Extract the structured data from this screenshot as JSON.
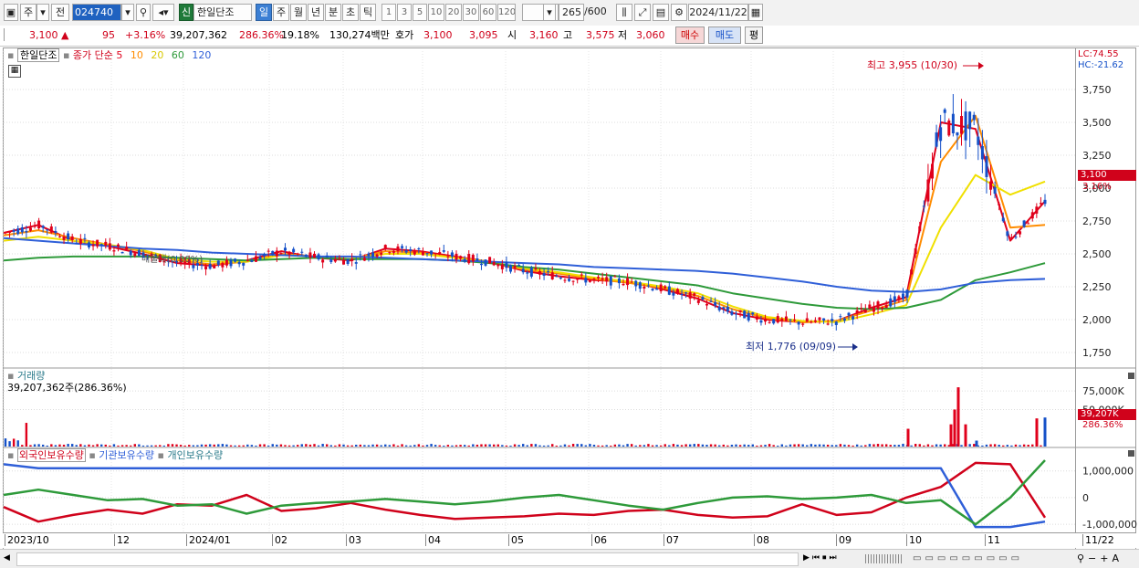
{
  "toolbar": {
    "period_type": "주",
    "prev_label": "전",
    "stock_code": "024740",
    "new_badge": "신",
    "stock_name": "한일단조",
    "period_tabs": [
      "일",
      "주",
      "월",
      "년",
      "분",
      "초",
      "틱"
    ],
    "active_tab": "일",
    "interval_buttons": [
      "1",
      "3",
      "5",
      "10",
      "20",
      "30",
      "60",
      "120"
    ],
    "count_value": "265",
    "count_total": "/600",
    "date": "2024/11/22"
  },
  "quote": {
    "price": "3,100",
    "direction": "▲",
    "change": "95",
    "change_pct": "+3.16%",
    "volume": "39,207,362",
    "volume_ratio": "286.36%",
    "turnover": "19.18%",
    "amount": "130,274백만",
    "bid_ask_label": "호가",
    "bid": "3,100",
    "ask": "3,095",
    "open_label": "시",
    "open": "3,160",
    "high_label": "고",
    "high": "3,575",
    "low_label": "저",
    "low": "3,060",
    "buy_button": "매수",
    "sell_button": "매도",
    "eval_button": "평"
  },
  "price_panel": {
    "legend_name": "한일단조",
    "legend_ma_label": "종가 단순",
    "ma_periods": [
      "5",
      "10",
      "20",
      "60",
      "120"
    ],
    "ma_colors": [
      "#e0001b",
      "#ff8c00",
      "#f0e000",
      "#2e9a3a",
      "#2f5fd8"
    ],
    "lc": "LC:74.55",
    "hc": "HC:-21.62",
    "current_price_tag": "3,100",
    "current_pct_tag": "3.16%",
    "high_note": "최고 3,955 (10/30)",
    "low_note": "최저 1,776 (09/09)",
    "overlay_text": "매물대(0.00%)"
  },
  "volume_panel": {
    "legend": "거래량",
    "value": "39,207,362주(286.36%)",
    "tag_value": "39,207K",
    "tag_pct": "286.36%"
  },
  "investor_panel": {
    "legend_items": [
      "외국인보유수량",
      "기관보유수량",
      "개인보유수량"
    ],
    "legend_colors": [
      "#d0021b",
      "#2f5fd8",
      "#2e9a3a"
    ]
  },
  "x_axis": {
    "labels": [
      "2023/10",
      "12",
      "2024/01",
      "02",
      "03",
      "04",
      "05",
      "06",
      "07",
      "08",
      "09",
      "10",
      "11",
      "11/22"
    ]
  },
  "chart_data": [
    {
      "type": "candlestick",
      "title": "",
      "y_ticks": [
        "3,750",
        "3,500",
        "3,250",
        "3,000",
        "2,750",
        "2,500",
        "2,250",
        "2,000",
        "1,750"
      ],
      "ylim": [
        1750,
        3750
      ],
      "annotations": [
        "최고 3,955 (10/30)",
        "최저 1,776 (09/09)"
      ],
      "series": [
        {
          "name": "5",
          "values": [
            2660,
            2720,
            2600,
            2560,
            2500,
            2430,
            2410,
            2450,
            2520,
            2470,
            2450,
            2540,
            2520,
            2480,
            2440,
            2370,
            2330,
            2300,
            2290,
            2230,
            2160,
            2050,
            2000,
            1980,
            1990,
            2090,
            2170,
            3500,
            3450,
            2600,
            2900
          ]
        },
        {
          "name": "10",
          "values": [
            2640,
            2680,
            2620,
            2570,
            2520,
            2450,
            2420,
            2440,
            2500,
            2480,
            2460,
            2520,
            2510,
            2470,
            2440,
            2380,
            2350,
            2310,
            2280,
            2240,
            2180,
            2080,
            2010,
            1980,
            1990,
            2070,
            2150,
            3200,
            3550,
            2700,
            2720
          ]
        },
        {
          "name": "20",
          "values": [
            2600,
            2630,
            2600,
            2570,
            2530,
            2460,
            2440,
            2440,
            2490,
            2480,
            2460,
            2500,
            2500,
            2470,
            2440,
            2390,
            2360,
            2320,
            2290,
            2250,
            2200,
            2100,
            2020,
            1990,
            1980,
            2040,
            2110,
            2700,
            3100,
            2950,
            3050
          ]
        },
        {
          "name": "60",
          "values": [
            2450,
            2470,
            2480,
            2480,
            2480,
            2470,
            2460,
            2450,
            2460,
            2470,
            2460,
            2460,
            2460,
            2450,
            2430,
            2400,
            2380,
            2350,
            2320,
            2290,
            2260,
            2200,
            2160,
            2120,
            2090,
            2080,
            2090,
            2150,
            2300,
            2360,
            2430
          ]
        },
        {
          "name": "120",
          "values": [
            2620,
            2600,
            2580,
            2560,
            2540,
            2530,
            2510,
            2500,
            2490,
            2480,
            2480,
            2470,
            2460,
            2450,
            2440,
            2430,
            2420,
            2400,
            2390,
            2380,
            2370,
            2350,
            2320,
            2290,
            2250,
            2220,
            2210,
            2230,
            2280,
            2300,
            2310
          ]
        }
      ]
    },
    {
      "type": "bar",
      "title": "거래량",
      "y_ticks": [
        "75,000K",
        "50,000K"
      ],
      "ylim": [
        0,
        90000
      ],
      "highlights": [
        {
          "label": "10",
          "value": 24000
        },
        {
          "label": "10/30",
          "value": 80000
        },
        {
          "label": "11",
          "value": 30000
        },
        {
          "label": "11/22",
          "value": 39207
        }
      ]
    },
    {
      "type": "line",
      "title": "",
      "y_ticks": [
        "1,000,000",
        "0",
        "-1,000,000"
      ],
      "ylim": [
        -1200000,
        1400000
      ],
      "series": [
        {
          "name": "외국인보유수량",
          "values": [
            -350000,
            -900000,
            -650000,
            -450000,
            -600000,
            -250000,
            -300000,
            100000,
            -500000,
            -400000,
            -200000,
            -450000,
            -650000,
            -800000,
            -750000,
            -700000,
            -600000,
            -650000,
            -500000,
            -450000,
            -650000,
            -750000,
            -700000,
            -250000,
            -650000,
            -550000,
            0,
            400000,
            1300000,
            1250000,
            -750000
          ]
        },
        {
          "name": "기관보유수량",
          "values": [
            1250000,
            1100000,
            1100000,
            1100000,
            1100000,
            1100000,
            1100000,
            1100000,
            1100000,
            1100000,
            1100000,
            1100000,
            1100000,
            1100000,
            1100000,
            1100000,
            1100000,
            1100000,
            1100000,
            1100000,
            1100000,
            1100000,
            1100000,
            1100000,
            1100000,
            1100000,
            1100000,
            1100000,
            -1100000,
            -1100000,
            -900000
          ]
        },
        {
          "name": "개인보유수량",
          "values": [
            100000,
            300000,
            100000,
            -100000,
            -50000,
            -300000,
            -250000,
            -600000,
            -300000,
            -200000,
            -150000,
            -50000,
            -150000,
            -250000,
            -150000,
            0,
            100000,
            -100000,
            -300000,
            -450000,
            -200000,
            0,
            50000,
            -50000,
            0,
            100000,
            -200000,
            -100000,
            -1000000,
            0,
            1400000
          ]
        }
      ]
    }
  ]
}
